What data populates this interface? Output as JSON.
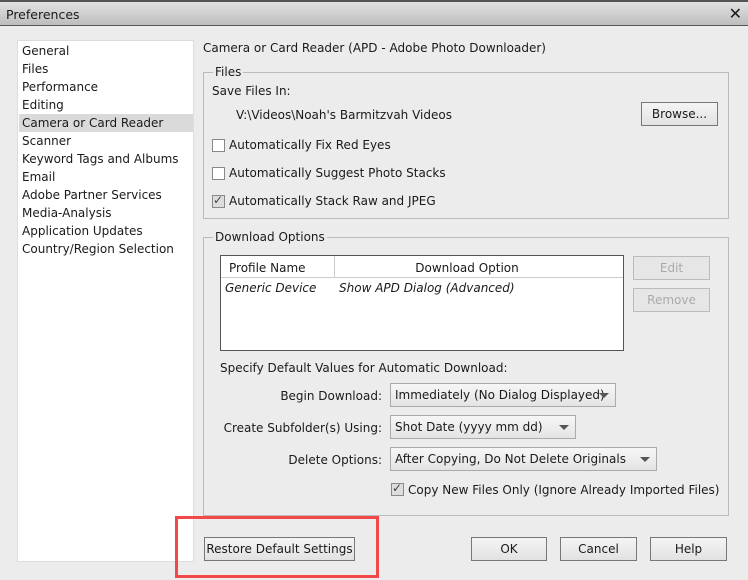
{
  "window": {
    "title": "Preferences",
    "close": "✕"
  },
  "sidebar": {
    "items": [
      {
        "label": "General"
      },
      {
        "label": "Files"
      },
      {
        "label": "Performance"
      },
      {
        "label": "Editing"
      },
      {
        "label": "Camera or Card Reader",
        "selected": true
      },
      {
        "label": "Scanner"
      },
      {
        "label": "Keyword Tags and Albums"
      },
      {
        "label": "Email"
      },
      {
        "label": "Adobe Partner Services"
      },
      {
        "label": "Media-Analysis"
      },
      {
        "label": "Application Updates"
      },
      {
        "label": "Country/Region Selection"
      }
    ]
  },
  "main": {
    "heading": "Camera or Card Reader (APD - Adobe Photo Downloader)",
    "files": {
      "legend": "Files",
      "save_label": "Save Files In:",
      "path": "V:\\Videos\\Noah's Barmitzvah Videos",
      "browse": "Browse...",
      "checks": [
        {
          "label": "Automatically Fix Red Eyes",
          "checked": false
        },
        {
          "label": "Automatically Suggest Photo Stacks",
          "checked": false
        },
        {
          "label": "Automatically Stack Raw and JPEG",
          "checked": true
        }
      ]
    },
    "download": {
      "legend": "Download Options",
      "columns": [
        "Profile Name",
        "Download Option"
      ],
      "rows": [
        [
          "Generic Device",
          "Show APD Dialog (Advanced)"
        ]
      ],
      "edit": "Edit",
      "remove": "Remove",
      "specify": "Specify Default Values for Automatic Download:",
      "begin_label": "Begin Download:",
      "begin_value": "Immediately (No Dialog Displayed)",
      "subfolder_label": "Create Subfolder(s) Using:",
      "subfolder_value": "Shot Date (yyyy mm dd)",
      "delete_label": "Delete Options:",
      "delete_value": "After Copying, Do Not Delete Originals",
      "copy_new": {
        "label": "Copy New Files Only (Ignore Already Imported Files)",
        "checked": true
      }
    }
  },
  "footer": {
    "restore": "Restore Default Settings",
    "ok": "OK",
    "cancel": "Cancel",
    "help": "Help"
  },
  "highlight_color": "#f24848"
}
